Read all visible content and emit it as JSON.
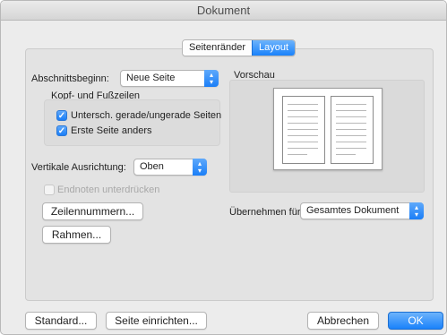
{
  "window": {
    "title": "Dokument"
  },
  "tabs": [
    {
      "label": "Seitenränder",
      "active": false
    },
    {
      "label": "Layout",
      "active": true
    }
  ],
  "section_start": {
    "label": "Abschnittsbeginn:",
    "value": "Neue Seite"
  },
  "header_footer": {
    "heading": "Kopf- und Fußzeilen",
    "options": [
      {
        "label": "Untersch. gerade/ungerade Seiten",
        "checked": true
      },
      {
        "label": "Erste Seite anders",
        "checked": true
      }
    ]
  },
  "vertical_alignment": {
    "label": "Vertikale Ausrichtung:",
    "value": "Oben"
  },
  "endnotes": {
    "label": "Endnoten unterdrücken",
    "checked": false,
    "enabled": false
  },
  "buttons": {
    "line_numbers": "Zeilennummern...",
    "borders": "Rahmen...",
    "default": "Standard...",
    "page_setup": "Seite einrichten...",
    "cancel": "Abbrechen",
    "ok": "OK"
  },
  "preview": {
    "label": "Vorschau"
  },
  "apply_to": {
    "label": "Übernehmen für:",
    "value": "Gesamtes Dokument"
  },
  "colors": {
    "accent": "#1a82fb",
    "panel": "#e3e3e3",
    "window": "#ececec"
  },
  "icons": {
    "checkbox": "checkmark-icon",
    "popup": "up-down-arrows-icon"
  }
}
